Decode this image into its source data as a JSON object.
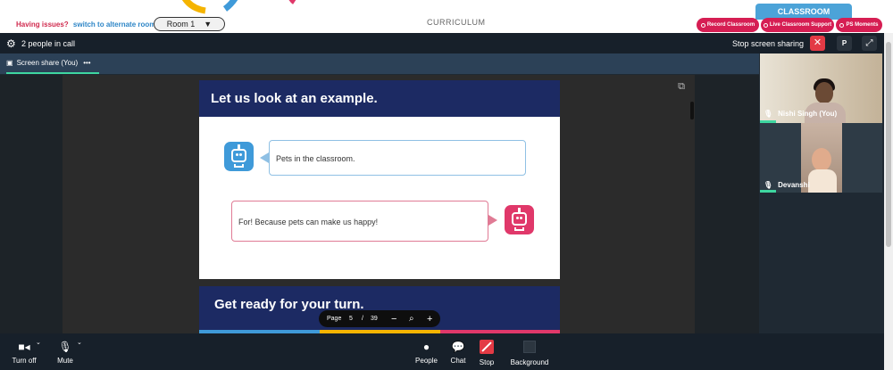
{
  "topbar": {
    "issues_text": "Having issues?",
    "alternate_link": "switch to alternate room",
    "room_value": "Room 1",
    "curriculum": "CURRICULUM",
    "classroom_tab": "CLASSROOM",
    "record_btn": "Record Classroom",
    "support_btn": "Live Classroom Support",
    "moments_btn": "PS Moments"
  },
  "call": {
    "people_count": "2 people in call",
    "stop_sharing": "Stop screen sharing",
    "p_button": "P",
    "screen_tab": "Screen share (You)",
    "more": "•••"
  },
  "slide": {
    "title": "Let us look at an example.",
    "bubble1": "Pets in the classroom.",
    "bubble2": "For! Because pets can make us happy!",
    "next_title": "Get ready for your turn."
  },
  "pager": {
    "label": "Page",
    "current": "5",
    "separator": "/",
    "total": "39"
  },
  "participants": [
    {
      "name": "Nishi Singh (You)"
    },
    {
      "name": "Devanshi"
    }
  ],
  "controls": {
    "turn_off": "Turn off",
    "mute": "Mute",
    "people": "People",
    "chat": "Chat",
    "stop": "Stop",
    "background": "Background"
  },
  "colors": {
    "brand_red": "#d61e53",
    "brand_blue": "#4ca3d8",
    "slide_navy": "#1c2a63",
    "accent_green": "#3ed6a0"
  }
}
